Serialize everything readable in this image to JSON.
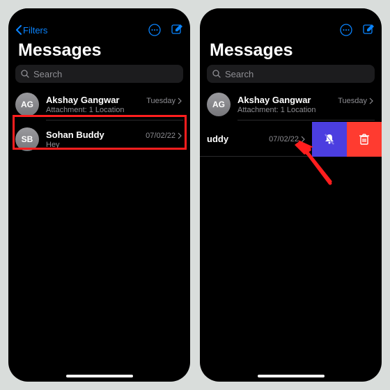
{
  "nav": {
    "back_label": "Filters"
  },
  "title": "Messages",
  "search": {
    "placeholder": "Search"
  },
  "left_screen": {
    "conversations": [
      {
        "initials": "AG",
        "name": "Akshay  Gangwar",
        "date": "Tuesday",
        "preview": "Attachment: 1 Location"
      },
      {
        "initials": "SB",
        "name": "Sohan Buddy",
        "date": "07/02/22",
        "preview": "Hey"
      }
    ]
  },
  "right_screen": {
    "conversations": [
      {
        "initials": "AG",
        "name": "Akshay  Gangwar",
        "date": "Tuesday",
        "preview": "Attachment: 1 Location"
      }
    ],
    "swiped": {
      "name_fragment": "uddy",
      "date": "07/02/22"
    }
  }
}
